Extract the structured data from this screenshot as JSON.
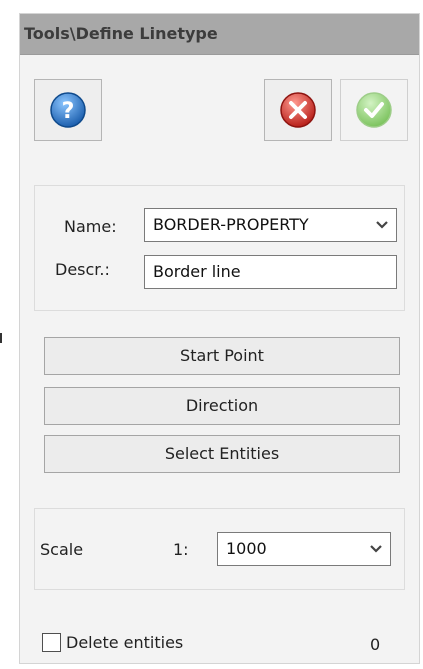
{
  "window": {
    "title": "Tools\\Define Linetype"
  },
  "toolbar": {
    "help_icon": "help-icon",
    "cancel_icon": "cancel-icon",
    "ok_icon": "ok-checkmark-icon",
    "colors": {
      "help_blue": "#2a7fd4",
      "cancel_red": "#d9342b",
      "ok_green": "#86cc6a"
    }
  },
  "properties": {
    "name_label": "Name:",
    "name_value": "BORDER-PROPERTY",
    "descr_label": "Descr.:",
    "descr_value": "Border line"
  },
  "actions": {
    "start_point": "Start Point",
    "direction": "Direction",
    "select_entities": "Select Entities"
  },
  "scale": {
    "label": "Scale",
    "prefix": "1:",
    "value": "1000"
  },
  "footer": {
    "delete_label": "Delete entities",
    "delete_checked": false,
    "count": "0"
  }
}
